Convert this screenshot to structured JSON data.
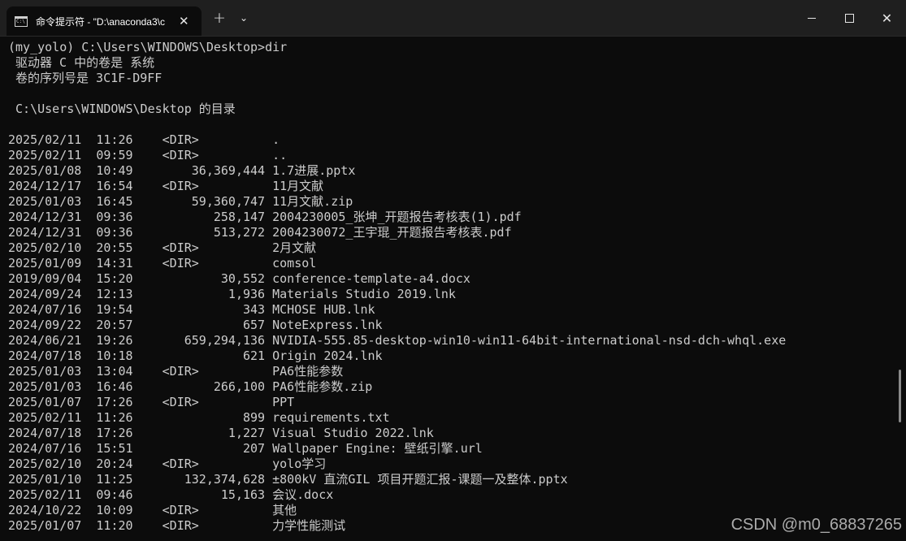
{
  "window": {
    "tab_title": "命令提示符 - \"D:\\anaconda3\\c",
    "icon_glyph": "C:\\",
    "tab_close": "✕",
    "new_tab": "+",
    "dropdown": "⌄",
    "close_glyph": "✕"
  },
  "terminal": {
    "lines": [
      "(my_yolo) C:\\Users\\WINDOWS\\Desktop>dir",
      " 驱动器 C 中的卷是 系统",
      " 卷的序列号是 3C1F-D9FF",
      "",
      " C:\\Users\\WINDOWS\\Desktop 的目录",
      "",
      "2025/02/11  11:26    <DIR>          .",
      "2025/02/11  09:59    <DIR>          ..",
      "2025/01/08  10:49        36,369,444 1.7进展.pptx",
      "2024/12/17  16:54    <DIR>          11月文献",
      "2025/01/03  16:45        59,360,747 11月文献.zip",
      "2024/12/31  09:36           258,147 2004230005_张坤_开题报告考核表(1).pdf",
      "2024/12/31  09:36           513,272 2004230072_王宇琨_开题报告考核表.pdf",
      "2025/02/10  20:55    <DIR>          2月文献",
      "2025/01/09  14:31    <DIR>          comsol",
      "2019/09/04  15:20            30,552 conference-template-a4.docx",
      "2024/09/24  12:13             1,936 Materials Studio 2019.lnk",
      "2024/07/16  19:54               343 MCHOSE HUB.lnk",
      "2024/09/22  20:57               657 NoteExpress.lnk",
      "2024/06/21  19:26       659,294,136 NVIDIA-555.85-desktop-win10-win11-64bit-international-nsd-dch-whql.exe",
      "2024/07/18  10:18               621 Origin 2024.lnk",
      "2025/01/03  13:04    <DIR>          PA6性能参数",
      "2025/01/03  16:46           266,100 PA6性能参数.zip",
      "2025/01/07  17:26    <DIR>          PPT",
      "2025/02/11  11:26               899 requirements.txt",
      "2024/07/18  17:26             1,227 Visual Studio 2022.lnk",
      "2024/07/16  15:51               207 Wallpaper Engine: 壁纸引擎.url",
      "2025/02/10  20:24    <DIR>          yolo学习",
      "2025/01/10  11:25       132,374,628 ±800kV 直流GIL 项目开题汇报-课题一及整体.pptx",
      "2025/02/11  09:46            15,163 会议.docx",
      "2024/10/22  10:09    <DIR>          其他",
      "2025/01/07  11:20    <DIR>          力学性能测试"
    ]
  },
  "watermark": "CSDN @m0_68837265"
}
